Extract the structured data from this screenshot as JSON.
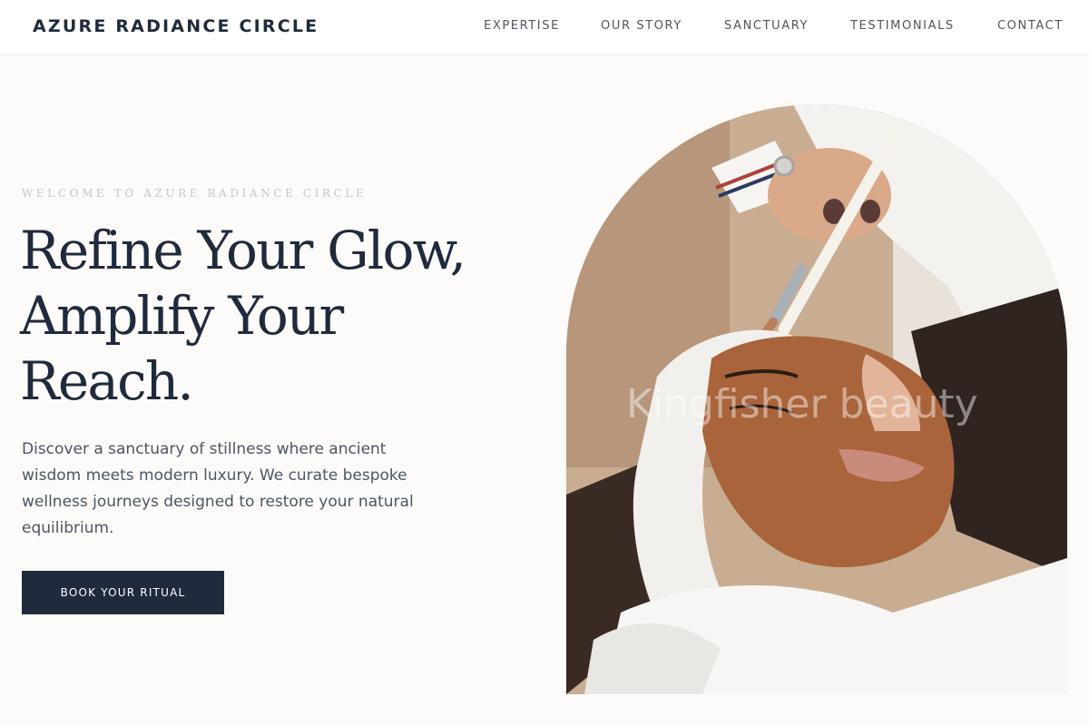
{
  "header": {
    "brand": "AZURE RADIANCE CIRCLE",
    "nav": [
      {
        "label": "EXPERTISE"
      },
      {
        "label": "OUR STORY"
      },
      {
        "label": "SANCTUARY"
      },
      {
        "label": "TESTIMONIALS"
      },
      {
        "label": "CONTACT"
      }
    ]
  },
  "hero": {
    "eyebrow": "WELCOME TO AZURE RADIANCE CIRCLE",
    "headline_lines": [
      "Refine Your Glow,",
      "Amplify Your",
      "Reach."
    ],
    "intro": "Discover a sanctuary of stillness where ancient wisdom meets modern luxury. We curate bespoke wellness journeys designed to restore your natural equilibrium.",
    "cta_label": "BOOK YOUR RITUAL",
    "image_watermark": "Kingfisher beauty"
  },
  "colors": {
    "ink": "#1f2a3c",
    "background": "#fcfbfa",
    "muted_text": "#4a5567",
    "eyebrow": "#c4c6cb"
  }
}
